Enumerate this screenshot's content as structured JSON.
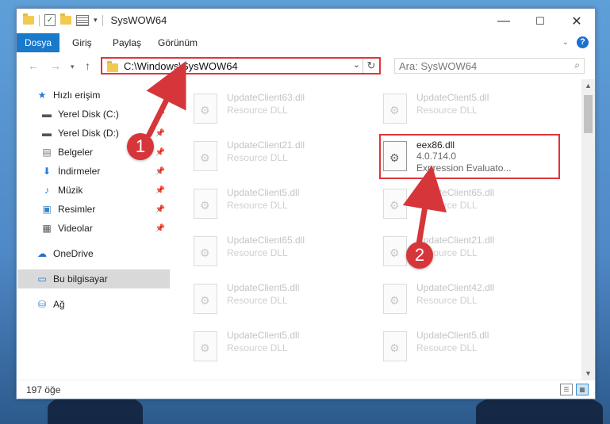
{
  "window": {
    "title": "SysWOW64",
    "controls": {
      "minimize": "—",
      "maximize": "☐",
      "close": "✕"
    }
  },
  "ribbon": {
    "tabs": [
      "Dosya",
      "Giriş",
      "Paylaş",
      "Görünüm"
    ]
  },
  "navigation": {
    "address": "C:\\Windows\\SysWOW64",
    "search_placeholder": "Ara: SysWOW64"
  },
  "sidebar": {
    "items": [
      {
        "label": "Hızlı erişim",
        "icon": "star-icon"
      },
      {
        "label": "Yerel Disk (C:)",
        "icon": "drive-icon"
      },
      {
        "label": "Yerel Disk (D:)",
        "icon": "drive-icon"
      },
      {
        "label": "Belgeler",
        "icon": "document-icon"
      },
      {
        "label": "İndirmeler",
        "icon": "download-icon"
      },
      {
        "label": "Müzik",
        "icon": "music-icon"
      },
      {
        "label": "Resimler",
        "icon": "pictures-icon"
      },
      {
        "label": "Videolar",
        "icon": "video-icon"
      },
      {
        "label": "OneDrive",
        "icon": "cloud-icon"
      },
      {
        "label": "Bu bilgisayar",
        "icon": "computer-icon"
      },
      {
        "label": "Ağ",
        "icon": "network-icon"
      }
    ]
  },
  "files": [
    {
      "name": "UpdateClient63.dll",
      "desc": "Resource DLL"
    },
    {
      "name": "UpdateClient5.dll",
      "desc": "Resource DLL"
    },
    {
      "name": "UpdateClient21.dll",
      "desc": "Resource DLL"
    },
    {
      "name": "eex86.dll",
      "version": "4.0.714.0",
      "desc": "Expression Evaluato..."
    },
    {
      "name": "UpdateClient5.dll",
      "desc": "Resource DLL"
    },
    {
      "name": "UpdateClient65.dll",
      "desc": "Resource DLL"
    },
    {
      "name": "UpdateClient65.dll",
      "desc": "Resource DLL"
    },
    {
      "name": "UpdateClient21.dll",
      "desc": "Resource DLL"
    },
    {
      "name": "UpdateClient5.dll",
      "desc": "Resource DLL"
    },
    {
      "name": "UpdateClient42.dll",
      "desc": "Resource DLL"
    },
    {
      "name": "UpdateClient5.dll",
      "desc": "Resource DLL"
    },
    {
      "name": "UpdateClient5.dll",
      "desc": "Resource DLL"
    }
  ],
  "status": {
    "item_count": "197 öğe"
  },
  "callouts": {
    "step1": "1",
    "step2": "2"
  },
  "colors": {
    "accent": "#1979ca",
    "highlight": "#e0353a"
  }
}
